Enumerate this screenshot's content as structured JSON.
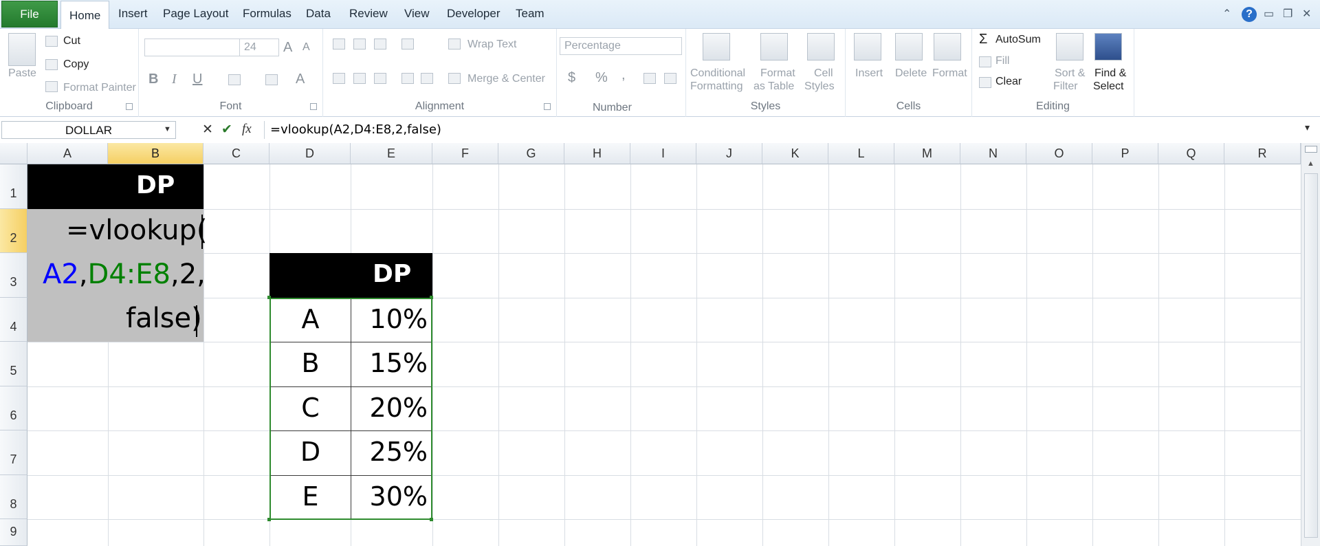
{
  "menu": {
    "file": "File",
    "tabs": [
      "Home",
      "Insert",
      "Page Layout",
      "Formulas",
      "Data",
      "Review",
      "View",
      "Developer",
      "Team"
    ],
    "active_tab": "Home",
    "window_controls": {
      "minimize_ribbon": "⌃",
      "help": "?",
      "minimize": "▭",
      "restore": "❐",
      "close": "✕"
    }
  },
  "ribbon": {
    "clipboard": {
      "label": "Clipboard",
      "paste": "Paste",
      "cut": "Cut",
      "copy": "Copy",
      "format_painter": "Format Painter"
    },
    "font": {
      "label": "Font",
      "font_name": "",
      "font_size": "24",
      "bold": "B",
      "italic": "I",
      "underline": "U"
    },
    "alignment": {
      "label": "Alignment",
      "wrap_text": "Wrap Text",
      "merge_center": "Merge & Center"
    },
    "number": {
      "label": "Number",
      "format": "Percentage",
      "currency": "$",
      "percent": "%",
      "comma": ","
    },
    "styles": {
      "label": "Styles",
      "conditional": [
        "Conditional",
        "Formatting"
      ],
      "format_table": [
        "Format",
        "as Table"
      ],
      "cell_styles": [
        "Cell",
        "Styles"
      ]
    },
    "cells": {
      "label": "Cells",
      "insert": "Insert",
      "delete": "Delete",
      "format": "Format"
    },
    "editing": {
      "label": "Editing",
      "autosum": "AutoSum",
      "fill": "Fill",
      "clear": "Clear",
      "sort": [
        "Sort &",
        "Filter"
      ],
      "find": [
        "Find &",
        "Select"
      ]
    }
  },
  "formula_bar": {
    "name_box": "DOLLAR",
    "cancel": "✕",
    "enter": "✔",
    "fx": "fx",
    "formula": "=vlookup(A2,D4:E8,2,false)"
  },
  "grid": {
    "columns": [
      "A",
      "B",
      "C",
      "D",
      "E",
      "F",
      "G",
      "H",
      "I",
      "J",
      "K",
      "L",
      "M",
      "N",
      "O",
      "P",
      "Q",
      "R"
    ],
    "rows": [
      "1",
      "2",
      "3",
      "4",
      "5",
      "6",
      "7",
      "8",
      "9"
    ],
    "b1_header": "DP",
    "edit_cell": {
      "line1": "=vlookup(",
      "ref1": "A2",
      "comma1": ",",
      "ref2": "D4:E8",
      "rest2": ",2,",
      "line3": "false)"
    },
    "lookup_table": {
      "header": "DP",
      "rows": [
        {
          "key": "A",
          "value": "10%"
        },
        {
          "key": "B",
          "value": "15%"
        },
        {
          "key": "C",
          "value": "20%"
        },
        {
          "key": "D",
          "value": "25%"
        },
        {
          "key": "E",
          "value": "30%"
        }
      ]
    }
  },
  "colors": {
    "file_tab": "#237a2d",
    "selected_header": "#f5cf63",
    "ref_blue": "#0000ff",
    "ref_green": "#008000",
    "edit_cell_bg": "#c0c0c0"
  }
}
